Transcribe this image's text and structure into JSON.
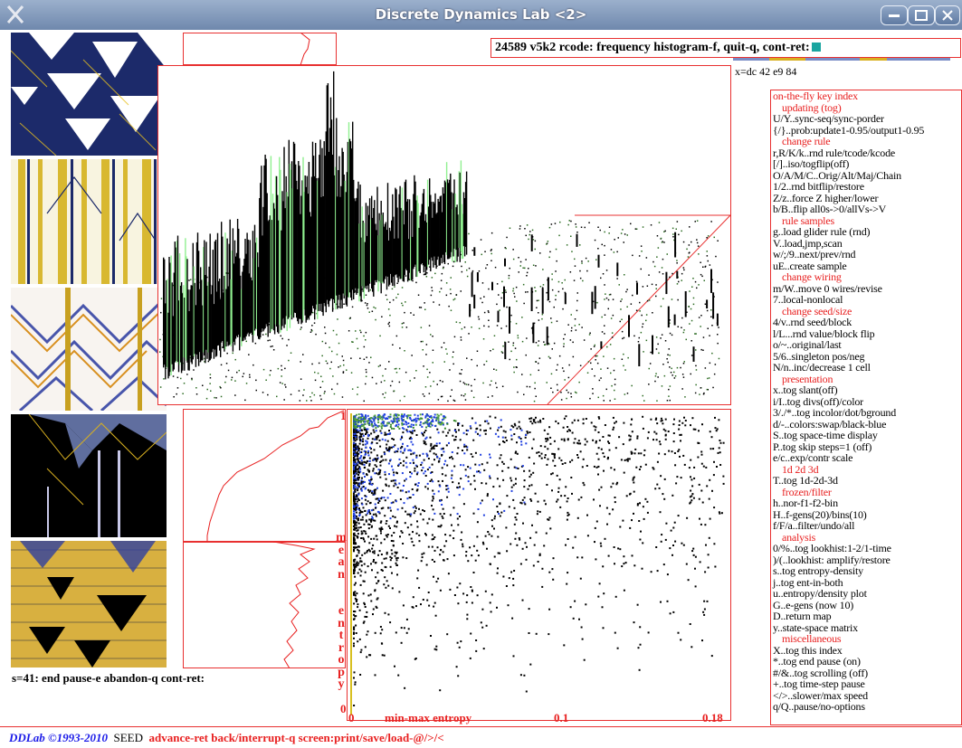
{
  "window": {
    "title": "Discrete Dynamics Lab <2>",
    "buttons": [
      "minimize",
      "maximize",
      "close"
    ]
  },
  "prompt": {
    "text": "24589 v5k2 rcode: frequency histogram-f, quit-q, cont-ret:",
    "cursor_color": "#1aa5a0"
  },
  "rule_line": "x=dc 42 e9 84",
  "key_index": {
    "title": "on-the-fly key index",
    "lines": [
      {
        "t": "updating (tog)",
        "h": true,
        "i": true
      },
      {
        "t": "U/Y..sync-seq/sync-porder"
      },
      {
        "t": "{/}..prob:update1-0.95/output1-0.95"
      },
      {
        "t": "change rule",
        "h": true,
        "i": true
      },
      {
        "t": "r,R/K/k..rnd rule/tcode/kcode"
      },
      {
        "t": "[/]..iso/togflip(off)"
      },
      {
        "t": "O/A/M/C..Orig/Alt/Maj/Chain"
      },
      {
        "t": "1/2..rnd bitflip/restore"
      },
      {
        "t": "Z/z..force Z higher/lower"
      },
      {
        "t": "b/B..flip all0s->0/allVs->V"
      },
      {
        "t": "rule samples",
        "h": true,
        "i": true
      },
      {
        "t": "g..load glider rule (rnd)"
      },
      {
        "t": "V..load,jmp,scan"
      },
      {
        "t": "w/;/9..next/prev/rnd"
      },
      {
        "t": "uE..create sample"
      },
      {
        "t": "change wiring",
        "h": true,
        "i": true
      },
      {
        "t": "m/W..move 0 wires/revise"
      },
      {
        "t": "7..local-nonlocal"
      },
      {
        "t": "change seed/size",
        "h": true,
        "i": true
      },
      {
        "t": "4/v..rnd seed/block"
      },
      {
        "t": "l/L...rnd value/block flip"
      },
      {
        "t": "o/~..original/last"
      },
      {
        "t": "5/6..singleton pos/neg"
      },
      {
        "t": "N/n..inc/decrease 1 cell"
      },
      {
        "t": "presentation",
        "h": true,
        "i": true
      },
      {
        "t": "x..tog slant(off)"
      },
      {
        "t": "i/I..tog divs(off)/color"
      },
      {
        "t": "3/./*..tog incolor/dot/bground"
      },
      {
        "t": "d/-..colors:swap/black-blue"
      },
      {
        "t": "S..tog space-time display"
      },
      {
        "t": "P..tog skip steps=1 (off)"
      },
      {
        "t": "e/c..exp/contr scale"
      },
      {
        "t": "1d 2d 3d",
        "h": true,
        "i": true
      },
      {
        "t": "T..tog 1d-2d-3d"
      },
      {
        "t": "frozen/filter",
        "h": true,
        "i": true
      },
      {
        "t": "h..nor-f1-f2-bin"
      },
      {
        "t": "H..f-gens(20)/bins(10)"
      },
      {
        "t": "f/F/a..filter/undo/all"
      },
      {
        "t": "analysis",
        "h": true,
        "i": true
      },
      {
        "t": "0/%..tog lookhist:1-2/1-time"
      },
      {
        "t": ")/(..lookhist: amplify/restore"
      },
      {
        "t": "s..tog entropy-density"
      },
      {
        "t": "j..tog ent-in-both"
      },
      {
        "t": "u..entropy/density plot"
      },
      {
        "t": "G..e-gens (now 10)"
      },
      {
        "t": "D..return map"
      },
      {
        "t": "y..state-space matrix"
      },
      {
        "t": "miscellaneous",
        "h": true,
        "i": true
      },
      {
        "t": "X..tog this index"
      },
      {
        "t": "*..tog end pause (on)"
      },
      {
        "t": "#/&..tog scrolling (off)"
      },
      {
        "t": "+..tog time-step pause"
      },
      {
        "t": "</>..slower/max speed"
      },
      {
        "t": "q/Q..pause/no-options"
      }
    ]
  },
  "status_line": "s=41: end pause-e abandon-q cont-ret:",
  "bottom_bar": {
    "logo": "DDLab ©1993-2010",
    "seed": "SEED",
    "commands": "advance-ret back/interrupt-q   screen:print/save/load-@/>/<"
  },
  "scatter_chart": {
    "type": "scatter",
    "ylabel": "mean entropy",
    "xlabel": "min-max entropy",
    "x_ticks": [
      "0",
      "0.1",
      "0.18"
    ],
    "y_ticks": [
      "1",
      "0"
    ],
    "xlim": [
      0,
      0.18
    ],
    "ylim": [
      0,
      1
    ]
  },
  "colors": {
    "frame": "#e83030",
    "accent_red": "#e82020",
    "logo_blue": "#1a1ae8",
    "histogram_green": "#90f090",
    "scatter_blue": "#2040e0"
  }
}
